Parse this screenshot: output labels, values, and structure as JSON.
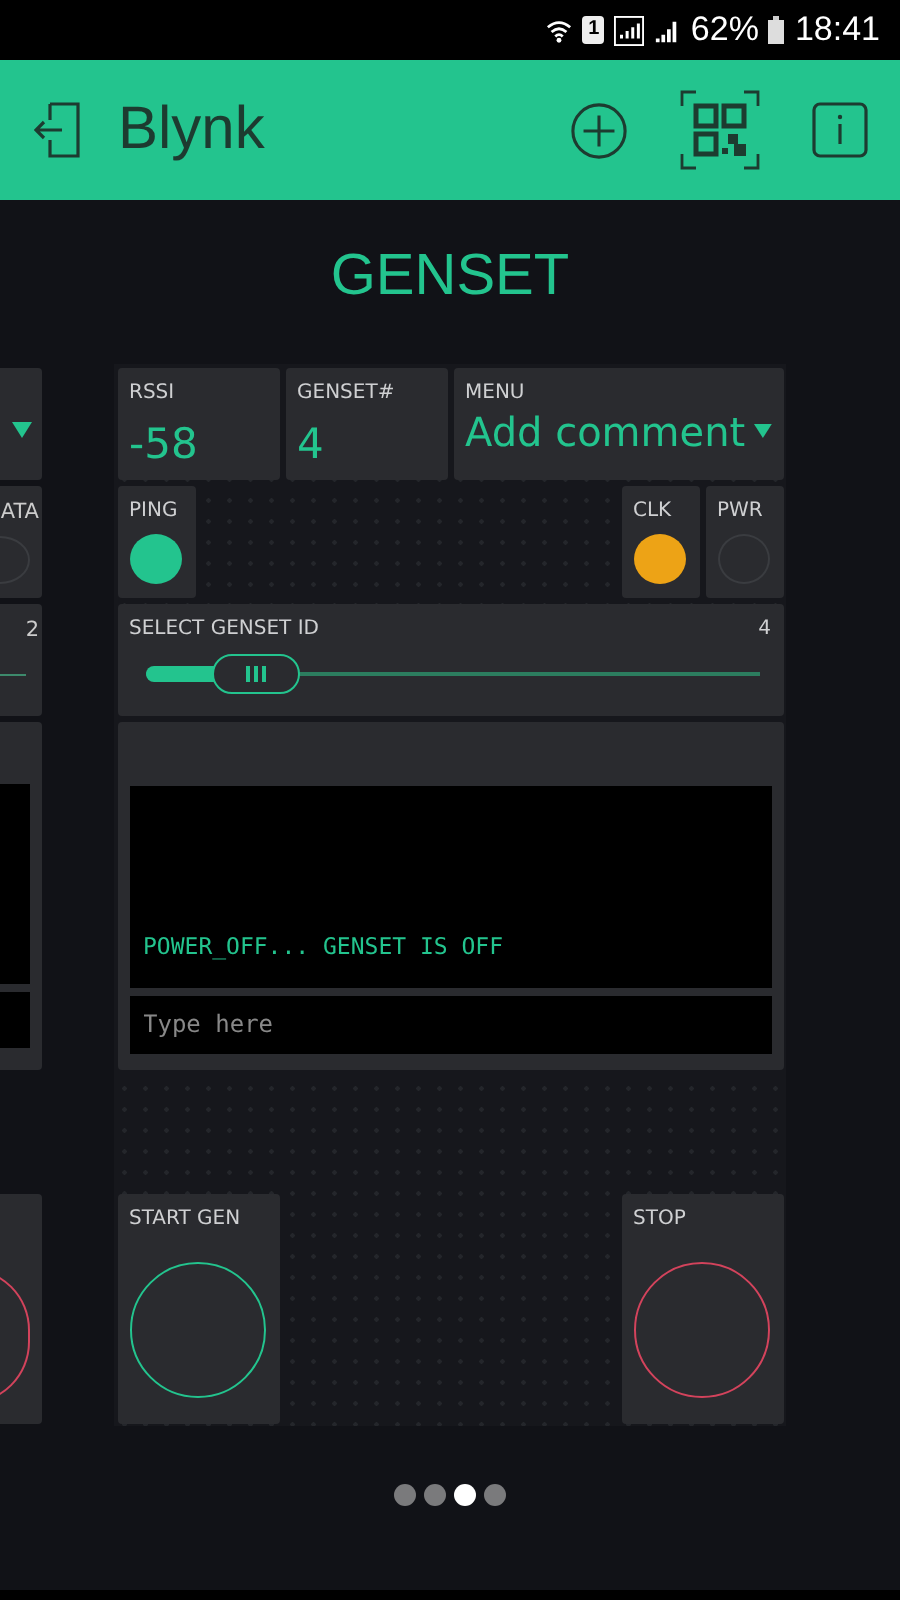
{
  "status_bar": {
    "sim_label": "1",
    "battery": "62%",
    "time": "18:41"
  },
  "header": {
    "title": "Blynk"
  },
  "dashboard": {
    "title": "GENSET"
  },
  "left_page_peek": {
    "texts": [
      "ATA",
      "2"
    ]
  },
  "widgets": [
    {
      "kind": "value",
      "label": "RSSI",
      "value": "-58"
    },
    {
      "kind": "value",
      "label": "GENSET#",
      "value": "4"
    },
    {
      "kind": "menu",
      "label": "MENU",
      "value": "Add comment"
    },
    {
      "kind": "led",
      "label": "PING",
      "lit": true,
      "color": "#23c48e"
    },
    {
      "kind": "led",
      "label": "CLK",
      "lit": true,
      "color": "#eda316"
    },
    {
      "kind": "led",
      "label": "PWR",
      "lit": false
    },
    {
      "kind": "slider",
      "label": "SELECT GENSET ID",
      "reading": "4",
      "level": 0.18
    },
    {
      "kind": "terminal",
      "output": "POWER_OFF... GENSET IS OFF",
      "placeholder": "Type here"
    },
    {
      "kind": "button",
      "label": "START GEN",
      "color": "#23c48e"
    },
    {
      "kind": "button",
      "label": "STOP",
      "color": "#d3435c"
    }
  ],
  "pages": [
    {
      "selected": false
    },
    {
      "selected": false
    },
    {
      "selected": true
    },
    {
      "selected": false
    }
  ]
}
